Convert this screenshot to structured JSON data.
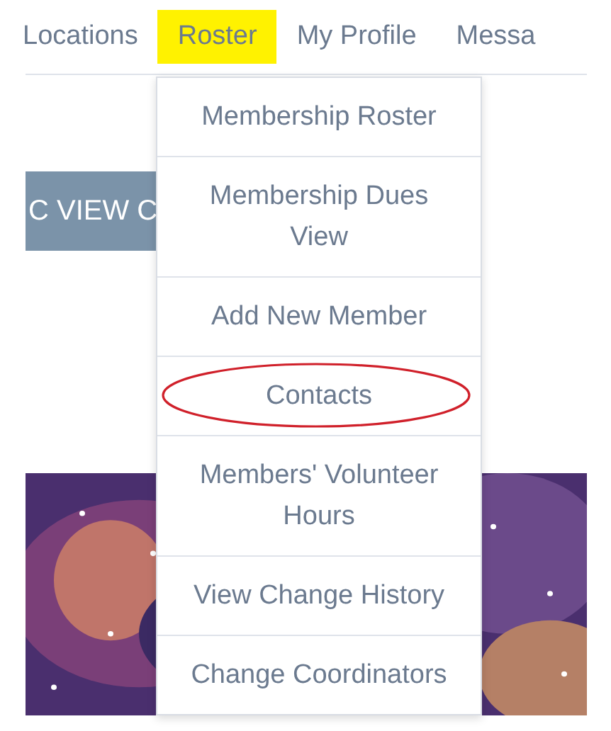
{
  "nav": [
    {
      "label": "Locations",
      "highlighted": false
    },
    {
      "label": "Roster",
      "highlighted": true
    },
    {
      "label": "My Profile",
      "highlighted": false
    },
    {
      "label": "Messa",
      "highlighted": false
    }
  ],
  "view_button": {
    "label": "C VIEW C"
  },
  "dropdown": [
    {
      "label": "Membership Roster",
      "circled": false
    },
    {
      "label": "Membership Dues View",
      "circled": false
    },
    {
      "label": "Add New Member",
      "circled": false
    },
    {
      "label": "Contacts",
      "circled": true
    },
    {
      "label": "Members' Volunteer Hours",
      "circled": false
    },
    {
      "label": "View Change History",
      "circled": false
    },
    {
      "label": "Change Coordinators",
      "circled": false
    }
  ]
}
